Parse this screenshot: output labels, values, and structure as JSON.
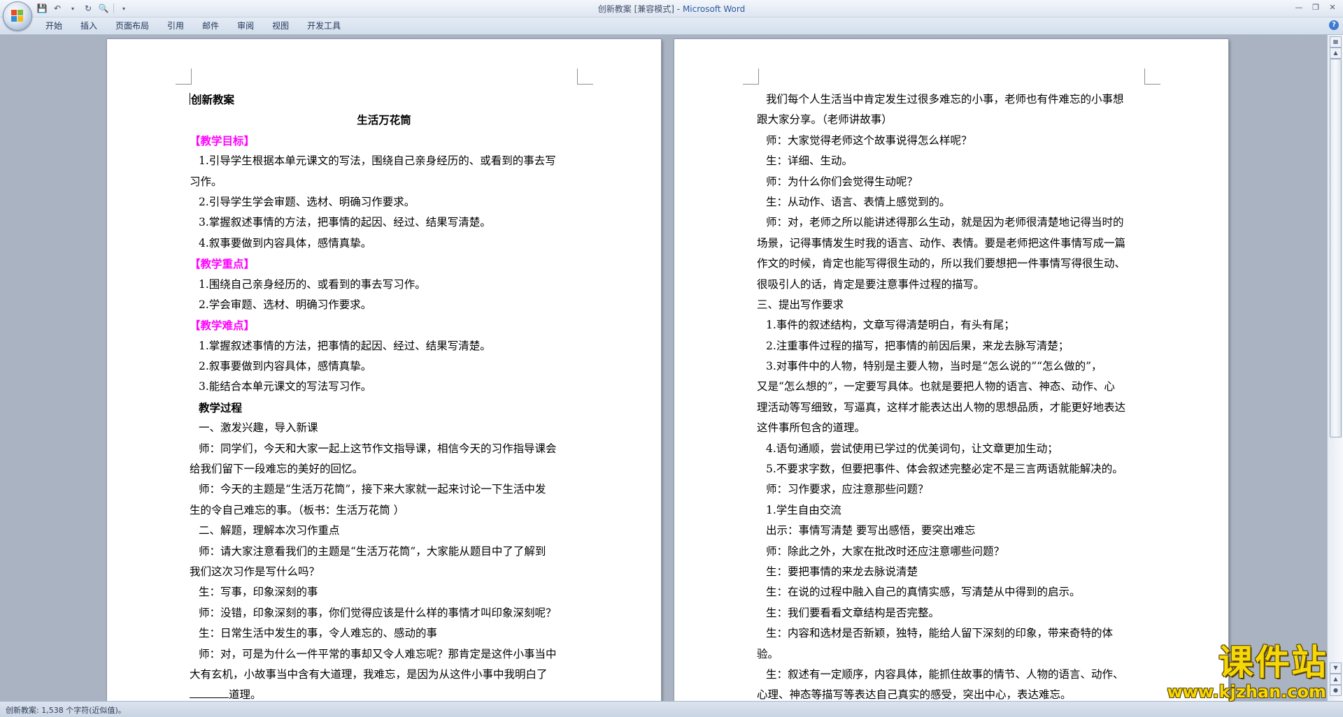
{
  "window": {
    "title": "创新教案 [兼容模式]",
    "separator": " - ",
    "app_name": "Microsoft Word"
  },
  "ribbon": {
    "tabs": [
      "开始",
      "插入",
      "页面布局",
      "引用",
      "邮件",
      "审阅",
      "视图",
      "开发工具"
    ]
  },
  "status": {
    "text": "创新教案: 1,538 个字符(近似值)。"
  },
  "watermark": {
    "brand": "课件站",
    "url": "www.kjzhan.com"
  },
  "page1": {
    "lines": [
      "创新教案",
      "生活万花筒",
      "【教学目标】",
      "1.引导学生根据本单元课文的写法，围绕自己亲身经历的、或看到的事去写",
      "习作。",
      "2.引导学生学会审题、选材、明确习作要求。",
      "3.掌握叙述事情的方法，把事情的起因、经过、结果写清楚。",
      "4.叙事要做到内容具体，感情真挚。",
      "【教学重点】",
      "1.围绕自己亲身经历的、或看到的事去写习作。",
      "2.学会审题、选材、明确习作要求。",
      "【教学难点】",
      "1.掌握叙述事情的方法，把事情的起因、经过、结果写清楚。",
      "2.叙事要做到内容具体，感情真挚。",
      "3.能结合本单元课文的写法写习作。",
      "教学过程",
      "一、激发兴趣，导入新课",
      "师：同学们，今天和大家一起上这节作文指导课，相信今天的习作指导课会",
      "给我们留下一段难忘的美好的回忆。",
      "师：今天的主题是“生活万花筒”，接下来大家就一起来讨论一下生活中发",
      "生的令自己难忘的事。（板书：生活万花筒 ）",
      "二、解题，理解本次习作重点",
      "师：请大家注意看我们的主题是“生活万花筒”，大家能从题目中了了解到",
      "我们这次习作是写什么吗？",
      "生：写事，印象深刻的事",
      "师：没错，印象深刻的事，你们觉得应该是什么样的事情才叫印象深刻呢？",
      "生：日常生活中发生的事，令人难忘的、感动的事",
      "师：对，可是为什么一件平常的事却又令人难忘呢？那肯定是这件小事当中",
      "大有玄机，小故事当中含有大道理，我难忘，是因为从这件小事中我明白了",
      "道理。"
    ]
  },
  "page2": {
    "lines": [
      "我们每个人生活当中肯定发生过很多难忘的小事，老师也有件难忘的小事想",
      "跟大家分享。（老师讲故事）",
      "师：大家觉得老师这个故事说得怎么样呢？",
      "生：详细、生动。",
      "师：为什么你们会觉得生动呢？",
      "生：从动作、语言、表情上感觉到的。",
      "师：对，老师之所以能讲述得那么生动，就是因为老师很清楚地记得当时的",
      "场景，记得事情发生时我的语言、动作、表情。要是老师把这件事情写成一篇",
      "作文的时候，肯定也能写得很生动的，所以我们要想把一件事情写得很生动、",
      "很吸引人的话，肯定是要注意事件过程的描写。",
      "三、提出写作要求",
      "1.事件的叙述结构，文章写得清楚明白，有头有尾；",
      "2.注重事件过程的描写，把事情的前因后果，来龙去脉写清楚；",
      "3.对事件中的人物，特别是主要人物，当时是“怎么说的”“怎么做的”，",
      "又是“怎么想的”，一定要写具体。也就是要把人物的语言、神态、动作、心",
      "理活动等写细致，写逼真，这样才能表达出人物的思想品质，才能更好地表达",
      "这件事所包含的道理。",
      "4.语句通顺，尝试使用已学过的优美词句，让文章更加生动；",
      "5.不要求字数，但要把事件、体会叙述完整必定不是三言两语就能解决的。",
      "师：习作要求，应注意那些问题？",
      "1.学生自由交流",
      "出示：事情写清楚 要写出感悟，要突出难忘",
      "师：除此之外，大家在批改时还应注意哪些问题？",
      "生：要把事情的来龙去脉说清楚",
      "生：在说的过程中融入自己的真情实感，写清楚从中得到的启示。",
      "生：我们要看看文章结构是否完整。",
      "生：内容和选材是否新颖，独特，能给人留下深刻的印象，带来奇特的体",
      "验。",
      "生：叙述有一定顺序，内容具体，能抓住故事的情节、人物的语言、动作、",
      "心理、神态等描写等表达自己真实的感受，突出中心，表达难忘。"
    ]
  }
}
